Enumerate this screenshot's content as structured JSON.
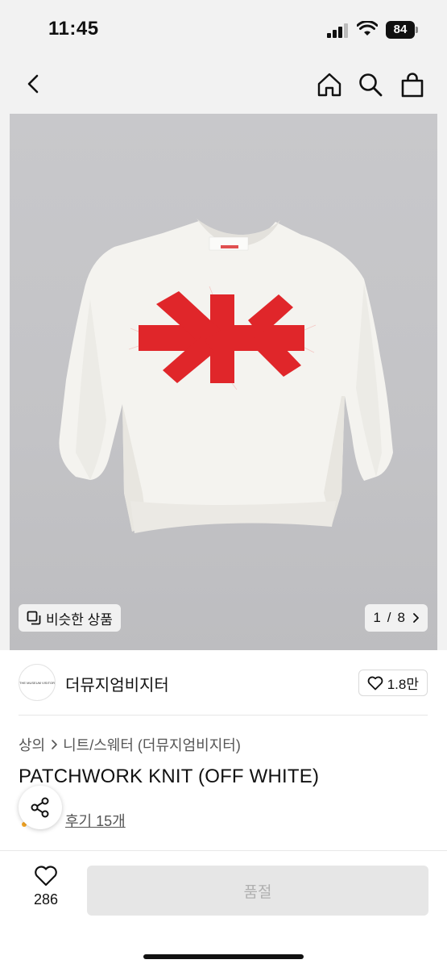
{
  "status_bar": {
    "time": "11:45",
    "battery": "84"
  },
  "product": {
    "similar_label": "비슷한 상품",
    "page_current": "1",
    "page_separator": "/",
    "page_total": "8",
    "brand_name": "더뮤지엄비지터",
    "brand_logo_text": "THE MUSEUM VISITOR",
    "brand_likes": "1.8만",
    "breadcrumb_root": "상의",
    "breadcrumb_sub": "니트/스웨터 (더뮤지엄비지터)",
    "title": "PATCHWORK KNIT (OFF WHITE)",
    "review_link": "후기 15개"
  },
  "bottom_bar": {
    "wish_count": "286",
    "soldout_label": "품절"
  },
  "icons": {
    "back": "chevron-left-icon",
    "home": "home-icon",
    "search": "search-icon",
    "bag": "shopping-bag-icon",
    "similar": "copy-icon",
    "heart": "heart-icon",
    "share": "share-icon"
  },
  "colors": {
    "background": "#f2f2f2",
    "image_bg": "#c6c6c9",
    "patch_red": "#e0262a",
    "sweater": "#f4f3ef",
    "soldout_bg": "#e6e6e6",
    "soldout_text": "#b0b0b0"
  }
}
